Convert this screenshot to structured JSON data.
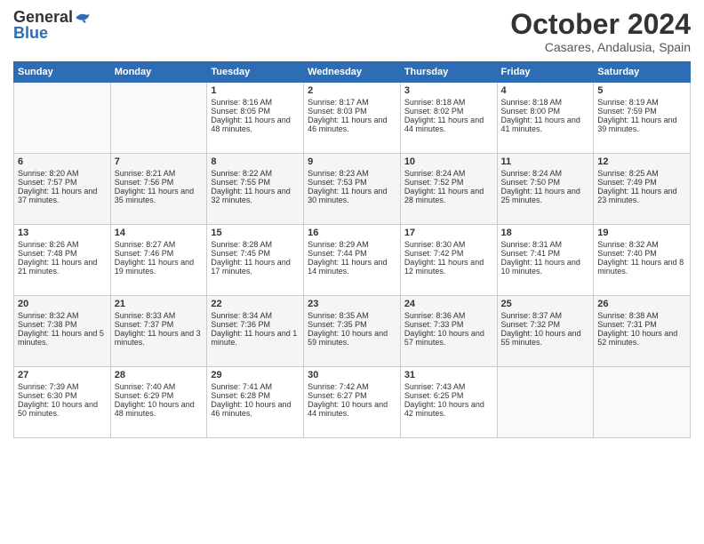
{
  "logo": {
    "line1": "General",
    "line2": "Blue"
  },
  "title": "October 2024",
  "subtitle": "Casares, Andalusia, Spain",
  "days_of_week": [
    "Sunday",
    "Monday",
    "Tuesday",
    "Wednesday",
    "Thursday",
    "Friday",
    "Saturday"
  ],
  "weeks": [
    [
      {
        "day": "",
        "content": ""
      },
      {
        "day": "",
        "content": ""
      },
      {
        "day": "1",
        "content": "Sunrise: 8:16 AM\nSunset: 8:05 PM\nDaylight: 11 hours and 48 minutes."
      },
      {
        "day": "2",
        "content": "Sunrise: 8:17 AM\nSunset: 8:03 PM\nDaylight: 11 hours and 46 minutes."
      },
      {
        "day": "3",
        "content": "Sunrise: 8:18 AM\nSunset: 8:02 PM\nDaylight: 11 hours and 44 minutes."
      },
      {
        "day": "4",
        "content": "Sunrise: 8:18 AM\nSunset: 8:00 PM\nDaylight: 11 hours and 41 minutes."
      },
      {
        "day": "5",
        "content": "Sunrise: 8:19 AM\nSunset: 7:59 PM\nDaylight: 11 hours and 39 minutes."
      }
    ],
    [
      {
        "day": "6",
        "content": "Sunrise: 8:20 AM\nSunset: 7:57 PM\nDaylight: 11 hours and 37 minutes."
      },
      {
        "day": "7",
        "content": "Sunrise: 8:21 AM\nSunset: 7:56 PM\nDaylight: 11 hours and 35 minutes."
      },
      {
        "day": "8",
        "content": "Sunrise: 8:22 AM\nSunset: 7:55 PM\nDaylight: 11 hours and 32 minutes."
      },
      {
        "day": "9",
        "content": "Sunrise: 8:23 AM\nSunset: 7:53 PM\nDaylight: 11 hours and 30 minutes."
      },
      {
        "day": "10",
        "content": "Sunrise: 8:24 AM\nSunset: 7:52 PM\nDaylight: 11 hours and 28 minutes."
      },
      {
        "day": "11",
        "content": "Sunrise: 8:24 AM\nSunset: 7:50 PM\nDaylight: 11 hours and 25 minutes."
      },
      {
        "day": "12",
        "content": "Sunrise: 8:25 AM\nSunset: 7:49 PM\nDaylight: 11 hours and 23 minutes."
      }
    ],
    [
      {
        "day": "13",
        "content": "Sunrise: 8:26 AM\nSunset: 7:48 PM\nDaylight: 11 hours and 21 minutes."
      },
      {
        "day": "14",
        "content": "Sunrise: 8:27 AM\nSunset: 7:46 PM\nDaylight: 11 hours and 19 minutes."
      },
      {
        "day": "15",
        "content": "Sunrise: 8:28 AM\nSunset: 7:45 PM\nDaylight: 11 hours and 17 minutes."
      },
      {
        "day": "16",
        "content": "Sunrise: 8:29 AM\nSunset: 7:44 PM\nDaylight: 11 hours and 14 minutes."
      },
      {
        "day": "17",
        "content": "Sunrise: 8:30 AM\nSunset: 7:42 PM\nDaylight: 11 hours and 12 minutes."
      },
      {
        "day": "18",
        "content": "Sunrise: 8:31 AM\nSunset: 7:41 PM\nDaylight: 11 hours and 10 minutes."
      },
      {
        "day": "19",
        "content": "Sunrise: 8:32 AM\nSunset: 7:40 PM\nDaylight: 11 hours and 8 minutes."
      }
    ],
    [
      {
        "day": "20",
        "content": "Sunrise: 8:32 AM\nSunset: 7:38 PM\nDaylight: 11 hours and 5 minutes."
      },
      {
        "day": "21",
        "content": "Sunrise: 8:33 AM\nSunset: 7:37 PM\nDaylight: 11 hours and 3 minutes."
      },
      {
        "day": "22",
        "content": "Sunrise: 8:34 AM\nSunset: 7:36 PM\nDaylight: 11 hours and 1 minute."
      },
      {
        "day": "23",
        "content": "Sunrise: 8:35 AM\nSunset: 7:35 PM\nDaylight: 10 hours and 59 minutes."
      },
      {
        "day": "24",
        "content": "Sunrise: 8:36 AM\nSunset: 7:33 PM\nDaylight: 10 hours and 57 minutes."
      },
      {
        "day": "25",
        "content": "Sunrise: 8:37 AM\nSunset: 7:32 PM\nDaylight: 10 hours and 55 minutes."
      },
      {
        "day": "26",
        "content": "Sunrise: 8:38 AM\nSunset: 7:31 PM\nDaylight: 10 hours and 52 minutes."
      }
    ],
    [
      {
        "day": "27",
        "content": "Sunrise: 7:39 AM\nSunset: 6:30 PM\nDaylight: 10 hours and 50 minutes."
      },
      {
        "day": "28",
        "content": "Sunrise: 7:40 AM\nSunset: 6:29 PM\nDaylight: 10 hours and 48 minutes."
      },
      {
        "day": "29",
        "content": "Sunrise: 7:41 AM\nSunset: 6:28 PM\nDaylight: 10 hours and 46 minutes."
      },
      {
        "day": "30",
        "content": "Sunrise: 7:42 AM\nSunset: 6:27 PM\nDaylight: 10 hours and 44 minutes."
      },
      {
        "day": "31",
        "content": "Sunrise: 7:43 AM\nSunset: 6:25 PM\nDaylight: 10 hours and 42 minutes."
      },
      {
        "day": "",
        "content": ""
      },
      {
        "day": "",
        "content": ""
      }
    ]
  ]
}
